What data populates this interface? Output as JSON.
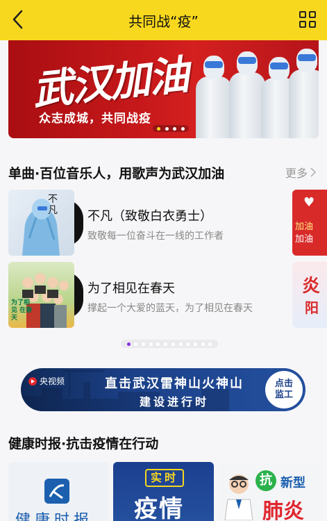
{
  "header": {
    "title": "共同战“疫”",
    "back_icon": "chevron-left-icon",
    "menu_icon": "grid-icon"
  },
  "banner": {
    "headline": "武汉加油",
    "subtitle": "众志成城，共同战疫",
    "slide_count": 4,
    "active_slide": 1
  },
  "music_section": {
    "title": "单曲·百位音乐人，用歌声为武汉加油",
    "more_label": "更多",
    "songs": [
      {
        "title": "不凡（致敬白衣勇士）",
        "desc": "致敬每一位奋斗在一线的工作者",
        "art_text": "不凡"
      },
      {
        "title": "为了相见在春天",
        "desc": "撑起一个大爱的蓝天，为了相见在春天",
        "art_text": "为了相见 在春天"
      }
    ],
    "side_cards": [
      {
        "line1": "加油",
        "line2": "加油"
      },
      {
        "line1": "炎",
        "line2": "阳"
      }
    ],
    "page_dots": 12,
    "active_page": 1
  },
  "cctv_banner": {
    "logo": "央视频",
    "line1": "直击武汉雷神山火神山",
    "line2": "建设进行时",
    "button": "点击 监工"
  },
  "health_section": {
    "title": "健康时报·抗击疫情在行动",
    "cards": [
      {
        "text": "健康时报"
      },
      {
        "top": "实时",
        "main": "疫情"
      },
      {
        "badge": "抗",
        "line1": "新型",
        "line2": "肺炎"
      }
    ]
  },
  "colors": {
    "header_bg": "#f8d81e",
    "banner_red": "#c8191b",
    "accent_purple": "#8a2be2",
    "cctv_blue": "#1c4189"
  }
}
